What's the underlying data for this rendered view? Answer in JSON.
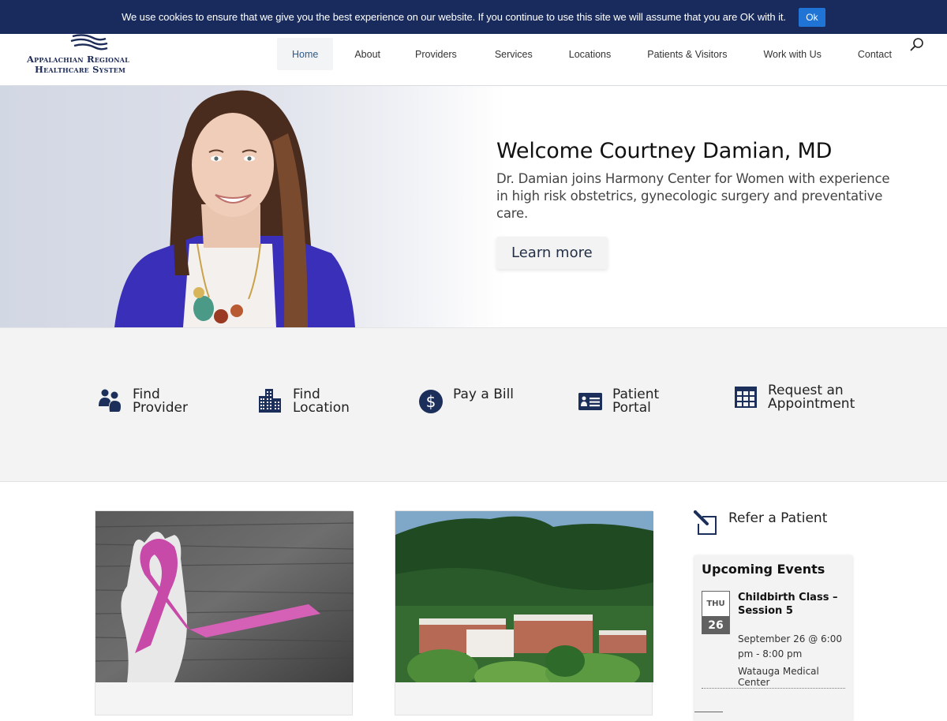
{
  "cookie_bar": {
    "message": "We use cookies to ensure that we give you the best experience on our website. If you continue to use this site we will assume that you are OK with it.",
    "ok_label": "Ok"
  },
  "header": {
    "logo": {
      "line1": "Appalachian Regional",
      "line2": "Healthcare System"
    },
    "nav": [
      {
        "label": "Home",
        "active": true
      },
      {
        "label": "About"
      },
      {
        "label": "Providers"
      },
      {
        "label": "Services"
      },
      {
        "label": "Locations"
      },
      {
        "label": "Patients & Visitors"
      },
      {
        "label": "Work with Us"
      },
      {
        "label": "Contact"
      }
    ],
    "search_icon": "search-icon"
  },
  "hero": {
    "title": "Welcome Courtney Damian, MD",
    "description": "Dr. Damian joins Harmony Center for Women with experience in high risk obstetrics, gynecologic surgery and preventative care.",
    "button_label": "Learn more"
  },
  "quick_links": [
    {
      "line1": "Find",
      "line2": "Provider",
      "icon": "users-icon"
    },
    {
      "line1": "Find",
      "line2": "Location",
      "icon": "building-icon"
    },
    {
      "line1": "Pay a Bill",
      "line2": "",
      "icon": "dollar-circle-icon"
    },
    {
      "line1": "Patient",
      "line2": "Portal",
      "icon": "id-card-icon"
    },
    {
      "line1": "Request an",
      "line2": "Appointment",
      "icon": "calendar-grid-icon"
    }
  ],
  "cards": [
    {
      "image": "pink ribbon in hand"
    },
    {
      "image": "hospital campus below mountain"
    }
  ],
  "sidebar": {
    "refer_label": "Refer a Patient",
    "events_title": "Upcoming Events",
    "events": [
      {
        "dow": "THU",
        "day": "26",
        "title": "Childbirth Class – Session 5",
        "when": "September 26 @ 6:00 pm - 8:00 pm",
        "venue": "Watauga Medical Center"
      }
    ]
  },
  "colors": {
    "brand_navy": "#182b5c",
    "ok_button": "#1f74d6",
    "icon_navy": "#1c2f5a",
    "active_nav_text": "#2d5b8c"
  }
}
